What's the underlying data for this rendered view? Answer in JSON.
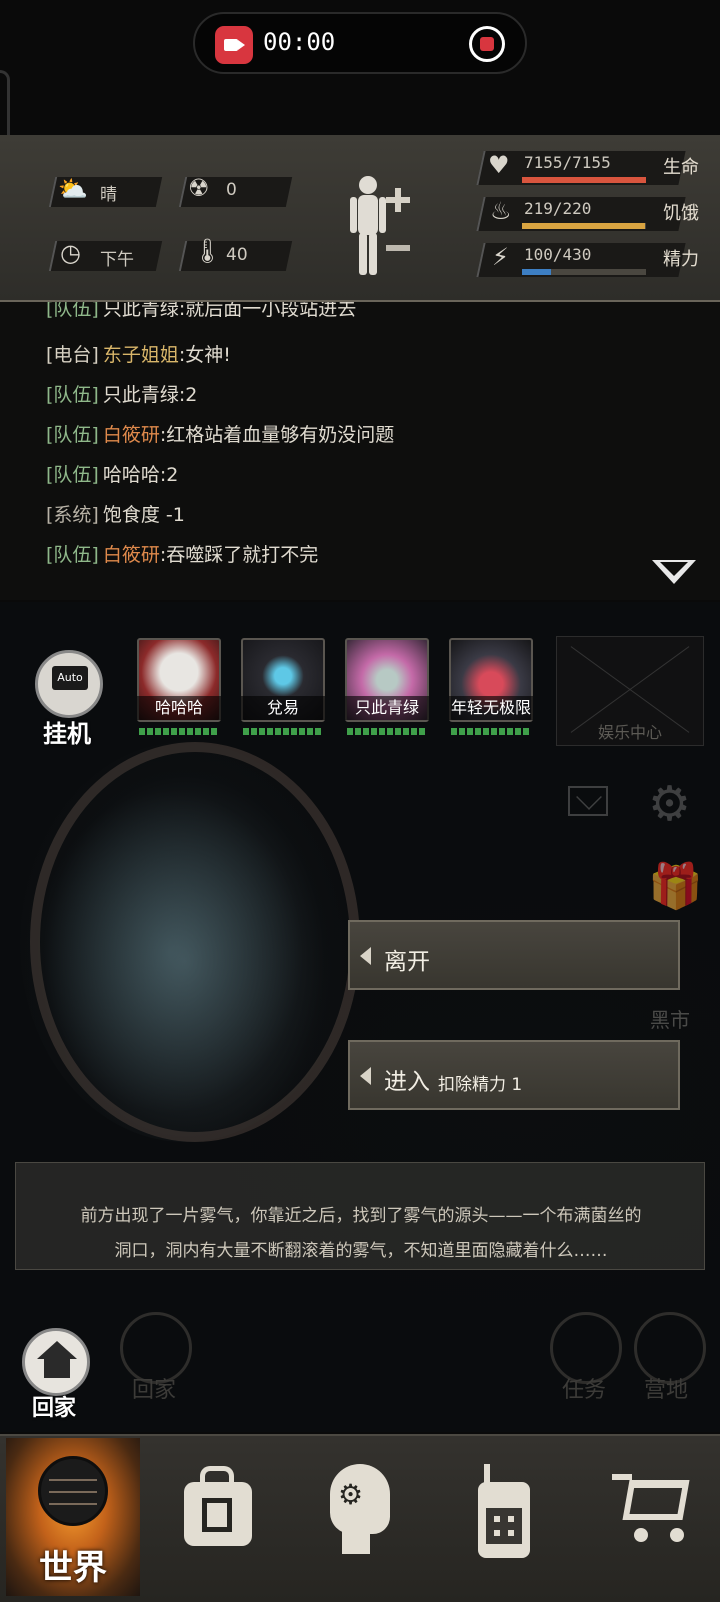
{
  "recording": {
    "time": "00:00"
  },
  "status": {
    "weather": "晴",
    "radiation": "0",
    "time_of_day": "下午",
    "temperature": "40",
    "life": {
      "label": "生命",
      "value": "7155/7155",
      "fraction": 1.0,
      "color": "#d9553e"
    },
    "hunger": {
      "label": "饥饿",
      "value": "219/220",
      "fraction": 0.995,
      "color": "#d9a441"
    },
    "energy": {
      "label": "精力",
      "value": "100/430",
      "fraction": 0.233,
      "color": "#3d7fc4"
    }
  },
  "chat": [
    {
      "channel": "[队伍]",
      "name": "只此青绿",
      "text": ":就后面一小段站进去",
      "ch_class": "ch-team",
      "name_class": "n-white"
    },
    {
      "channel": "[电台]",
      "name": "东子姐姐",
      "text": ":女神!",
      "ch_class": "ch-radio",
      "name_class": "n-gold"
    },
    {
      "channel": "[队伍]",
      "name": "只此青绿",
      "text": ":2",
      "ch_class": "ch-team",
      "name_class": "n-white"
    },
    {
      "channel": "[队伍]",
      "name": "白筱研",
      "text": ":红格站着血量够有奶没问题",
      "ch_class": "ch-team",
      "name_class": "n-orange"
    },
    {
      "channel": "[队伍]",
      "name": "哈哈哈",
      "text": ":2",
      "ch_class": "ch-team",
      "name_class": "n-white"
    },
    {
      "channel": "[系统]",
      "name": "饱食度",
      "text": " -1",
      "ch_class": "ch-sys",
      "name_class": "n-white"
    },
    {
      "channel": "[队伍]",
      "name": "白筱研",
      "text": ":吞噬踩了就打不完",
      "ch_class": "ch-team",
      "name_class": "n-orange"
    }
  ],
  "auto": {
    "screen": "Auto",
    "label": "挂机"
  },
  "team": [
    {
      "name": "哈哈哈"
    },
    {
      "name": "兌易"
    },
    {
      "name": "只此青绿"
    },
    {
      "name": "年轻无极限"
    }
  ],
  "entertainment_center": "娱乐中心",
  "black_market": "黑市",
  "options": {
    "leave": "离开",
    "enter": "进入",
    "enter_cost": "扣除精力 1"
  },
  "narrative": {
    "line1": "前方出现了一片雾气，你靠近之后，找到了雾气的源头——一个布满菌丝的",
    "line2": "洞口，洞内有大量不断翻滚着的雾气，不知道里面隐藏着什么……"
  },
  "scene_buttons": {
    "home": "回家",
    "home_ghost": "回家",
    "task": "任务",
    "camp": "营地"
  },
  "nav": {
    "world": "世界"
  }
}
